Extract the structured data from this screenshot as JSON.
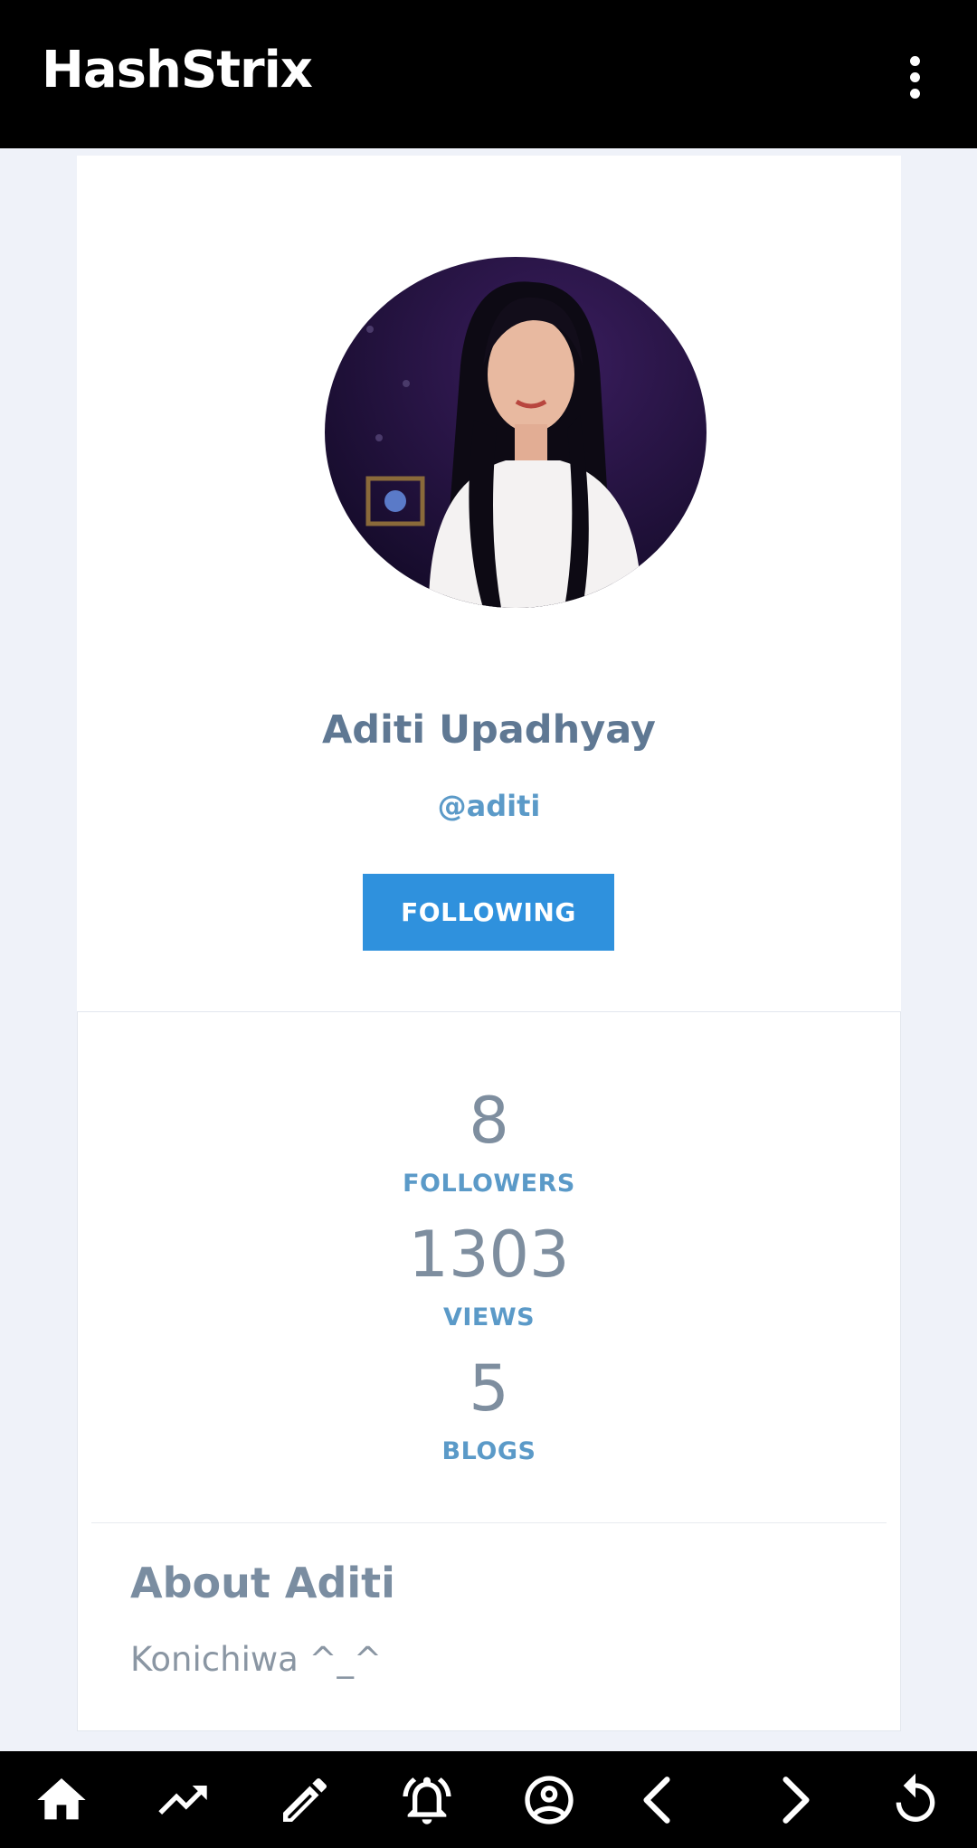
{
  "app": {
    "title": "HashStrix"
  },
  "profile": {
    "name": "Aditi Upadhyay",
    "handle": "@aditi",
    "follow_label": "FOLLOWING"
  },
  "stats": {
    "followers": {
      "value": "8",
      "label": "FOLLOWERS"
    },
    "views": {
      "value": "1303",
      "label": "VIEWS"
    },
    "blogs": {
      "value": "5",
      "label": "BLOGS"
    }
  },
  "about": {
    "title": "About Aditi",
    "text": "Konichiwa ^_^"
  },
  "bottom_nav": {
    "icons": [
      "home-icon",
      "trending-icon",
      "edit-icon",
      "notifications-icon",
      "account-icon",
      "back-icon",
      "forward-icon",
      "refresh-icon"
    ]
  },
  "colors": {
    "accent": "#2f91dd",
    "name_text": "#5f7893",
    "label_text": "#5b9ac8",
    "background": "#eff2f9"
  }
}
